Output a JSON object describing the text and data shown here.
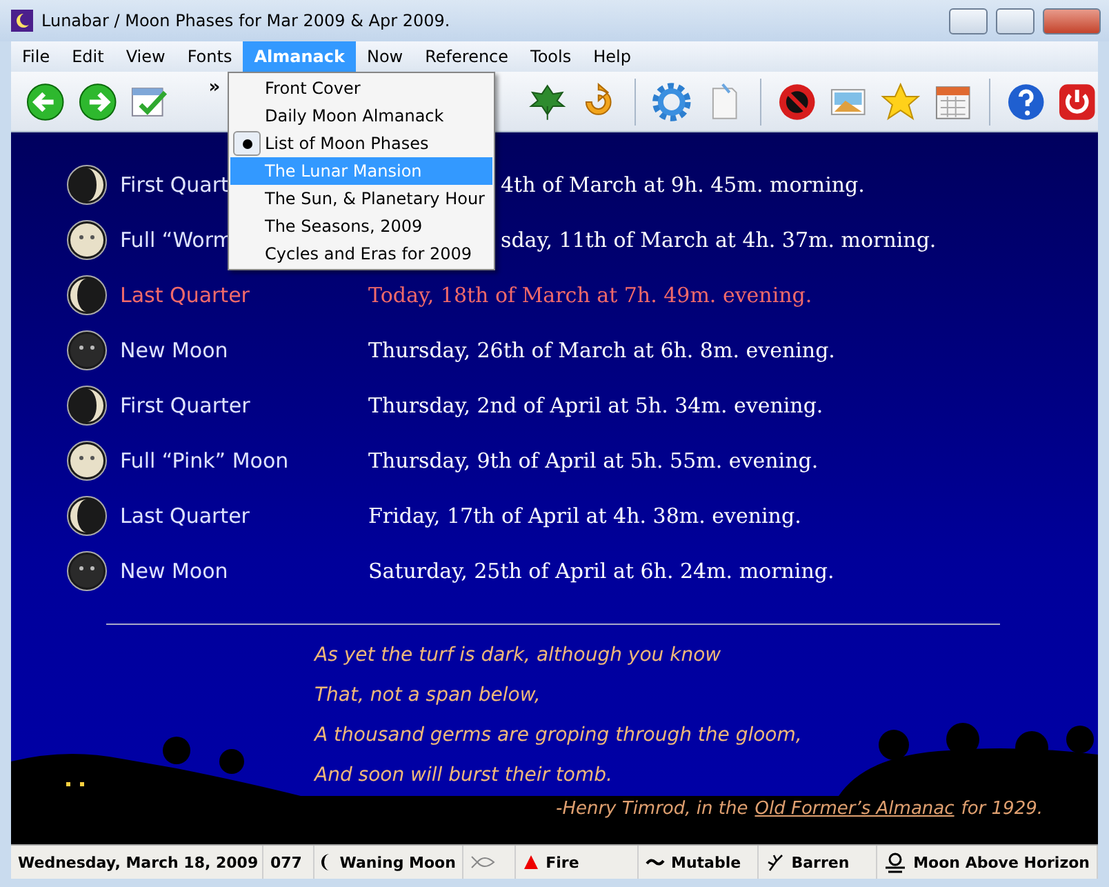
{
  "window": {
    "title": "Lunabar / Moon Phases for Mar 2009 & Apr 2009."
  },
  "menu_bar": [
    {
      "label": "File",
      "selected": false
    },
    {
      "label": "Edit",
      "selected": false
    },
    {
      "label": "View",
      "selected": false
    },
    {
      "label": "Fonts",
      "selected": false
    },
    {
      "label": "Almanack",
      "selected": true
    },
    {
      "label": "Now",
      "selected": false
    },
    {
      "label": "Reference",
      "selected": false
    },
    {
      "label": "Tools",
      "selected": false
    },
    {
      "label": "Help",
      "selected": false
    }
  ],
  "almanack_menu": [
    {
      "label": "Front Cover",
      "checked": false,
      "selected": false
    },
    {
      "label": "Daily Moon Almanack",
      "checked": false,
      "selected": false
    },
    {
      "label": "List of Moon Phases",
      "checked": true,
      "selected": false
    },
    {
      "label": "The Lunar Mansion",
      "checked": false,
      "selected": true
    },
    {
      "label": "The Sun, & Planetary Hour",
      "checked": false,
      "selected": false
    },
    {
      "label": "The Seasons, 2009",
      "checked": false,
      "selected": false
    },
    {
      "label": "Cycles and Eras for 2009",
      "checked": false,
      "selected": false
    }
  ],
  "toolbar": {
    "overflow": "»"
  },
  "phases": [
    {
      "kind": "first_quarter",
      "name": "First Quart",
      "date": "4th of March at 9h. 45m. morning.",
      "today": false
    },
    {
      "kind": "full",
      "name": "Full “Worm",
      "date": "sday, 11th of March at 4h. 37m. morning.",
      "today": false
    },
    {
      "kind": "last_quarter",
      "name": "Last Quarter",
      "date": "Today, 18th of March at 7h. 49m. evening.",
      "today": true
    },
    {
      "kind": "new",
      "name": "New Moon",
      "date": "Thursday, 26th of March at 6h. 8m. evening.",
      "today": false
    },
    {
      "kind": "first_quarter",
      "name": "First Quarter",
      "date": "Thursday, 2nd of April at 5h. 34m. evening.",
      "today": false
    },
    {
      "kind": "full",
      "name": "Full “Pink” Moon",
      "date": "Thursday, 9th of April at 5h. 55m. evening.",
      "today": false
    },
    {
      "kind": "last_quarter",
      "name": "Last Quarter",
      "date": "Friday, 17th of April at 4h. 38m. evening.",
      "today": false
    },
    {
      "kind": "new",
      "name": "New Moon",
      "date": "Saturday, 25th of April at 6h. 24m. morning.",
      "today": false
    }
  ],
  "poem": {
    "lines": [
      "As yet the turf is dark, although you know",
      "That, not a span below,",
      "A thousand germs are groping through the gloom,",
      "And soon will burst their tomb."
    ],
    "attribution_before": "-Henry Timrod, in the",
    "attribution_link": "Old Former’s Almanac",
    "attribution_after": "for 1929."
  },
  "status_bar": [
    {
      "kind": "text",
      "text": "Wednesday, March 18, 2009"
    },
    {
      "kind": "text",
      "text": "077"
    },
    {
      "kind": "waning",
      "text": "Waning Moon"
    },
    {
      "kind": "fish"
    },
    {
      "kind": "fire",
      "text": "Fire"
    },
    {
      "kind": "tilde",
      "text": "Mutable"
    },
    {
      "kind": "barren",
      "text": "Barren"
    },
    {
      "kind": "horizon",
      "text": "Moon Above Horizon"
    }
  ]
}
